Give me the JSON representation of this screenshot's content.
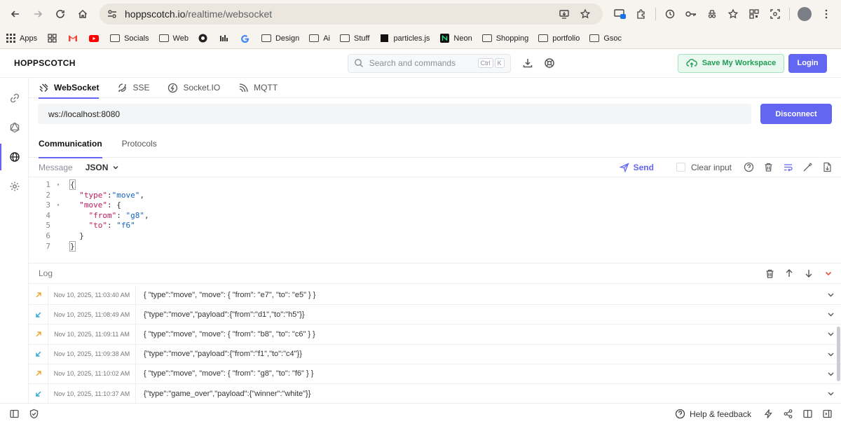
{
  "browser": {
    "url_host": "hoppscotch.io",
    "url_path": "/realtime/websocket",
    "bookmarks": [
      {
        "label": "Apps",
        "icon": "apps-grid-icon"
      },
      {
        "label": "",
        "icon": "grid-icon"
      },
      {
        "label": "",
        "icon": "gmail-icon"
      },
      {
        "label": "",
        "icon": "youtube-icon"
      },
      {
        "label": "Socials",
        "icon": "folder-icon"
      },
      {
        "label": "Web",
        "icon": "folder-icon"
      },
      {
        "label": "",
        "icon": "site-icon"
      },
      {
        "label": "",
        "icon": "site-icon-2"
      },
      {
        "label": "",
        "icon": "google-icon"
      },
      {
        "label": "Design",
        "icon": "folder-icon"
      },
      {
        "label": "Ai",
        "icon": "folder-icon"
      },
      {
        "label": "Stuff",
        "icon": "folder-icon"
      },
      {
        "label": "particles.js",
        "icon": "particles-icon"
      },
      {
        "label": "Neon",
        "icon": "neon-icon"
      },
      {
        "label": "Shopping",
        "icon": "folder-icon"
      },
      {
        "label": "portfolio",
        "icon": "folder-icon"
      },
      {
        "label": "Gsoc",
        "icon": "folder-icon"
      }
    ]
  },
  "app": {
    "brand": "HOPPSCOTCH",
    "search_placeholder": "Search and commands",
    "kbd_ctrl": "Ctrl",
    "kbd_k": "K",
    "save_workspace": "Save My Workspace",
    "login": "Login"
  },
  "tabs": [
    {
      "label": "WebSocket",
      "icon": "websocket-icon",
      "active": true
    },
    {
      "label": "SSE",
      "icon": "sse-icon",
      "active": false
    },
    {
      "label": "Socket.IO",
      "icon": "socketio-icon",
      "active": false
    },
    {
      "label": "MQTT",
      "icon": "mqtt-icon",
      "active": false
    }
  ],
  "connection": {
    "url": "ws://localhost:8080",
    "disconnect": "Disconnect"
  },
  "subtabs": {
    "communication": "Communication",
    "protocols": "Protocols"
  },
  "message": {
    "label": "Message",
    "format": "JSON",
    "send": "Send",
    "clear_input": "Clear input"
  },
  "editor": {
    "line_numbers": [
      "1",
      "2",
      "3",
      "4",
      "5",
      "6",
      "7"
    ]
  },
  "log": {
    "label": "Log",
    "entries": [
      {
        "direction": "sent",
        "time": "Nov 10, 2025, 11:03:40 AM",
        "message": "{ \"type\":\"move\", \"move\": { \"from\": \"e7\", \"to\": \"e5\" } }"
      },
      {
        "direction": "received",
        "time": "Nov 10, 2025, 11:08:49 AM",
        "message": "{\"type\":\"move\",\"payload\":{\"from\":\"d1\",\"to\":\"h5\"}}"
      },
      {
        "direction": "sent",
        "time": "Nov 10, 2025, 11:09:11 AM",
        "message": "{ \"type\":\"move\", \"move\": { \"from\": \"b8\", \"to\": \"c6\" } }"
      },
      {
        "direction": "received",
        "time": "Nov 10, 2025, 11:09:38 AM",
        "message": "{\"type\":\"move\",\"payload\":{\"from\":\"f1\",\"to\":\"c4\"}}"
      },
      {
        "direction": "sent",
        "time": "Nov 10, 2025, 11:10:02 AM",
        "message": "{ \"type\":\"move\", \"move\": { \"from\": \"g8\", \"to\": \"f6\" } }"
      },
      {
        "direction": "received",
        "time": "Nov 10, 2025, 11:10:37 AM",
        "message": "{\"type\":\"game_over\",\"payload\":{\"winner\":\"white\"}}"
      }
    ]
  },
  "footer": {
    "help": "Help & feedback"
  },
  "colors": {
    "accent": "#6366f1",
    "sent_arrow": "#f0a030",
    "received_arrow": "#29a3d6",
    "save_green": "#1f9d55"
  }
}
